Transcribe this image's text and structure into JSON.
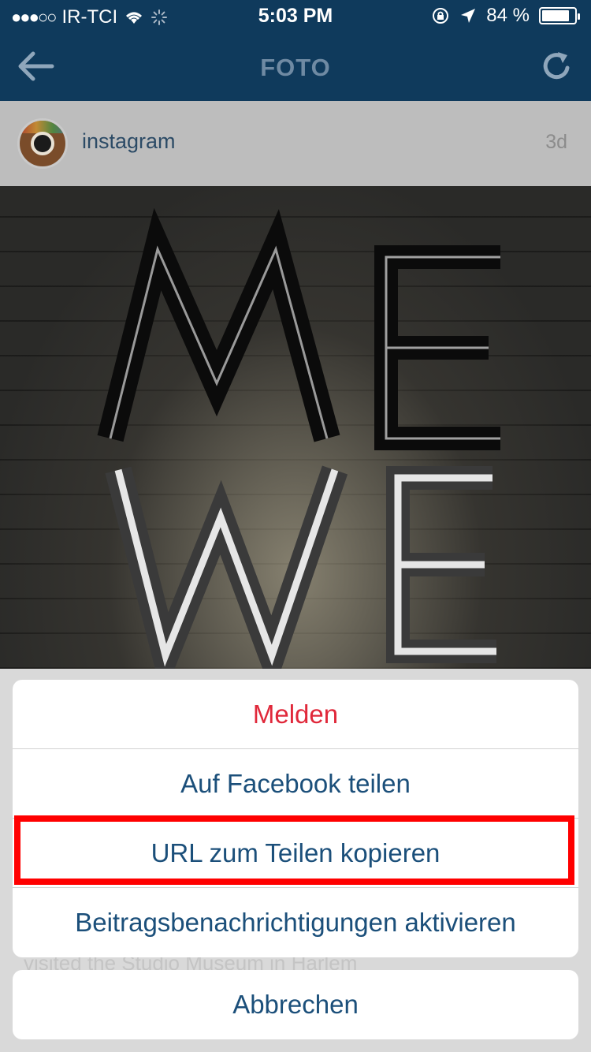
{
  "status_bar": {
    "carrier": "IR-TCI",
    "time": "5:03 PM",
    "battery_percent": "84 %",
    "battery_level": 0.84
  },
  "nav": {
    "title": "FOTO",
    "back_icon": "arrow-left-icon",
    "refresh_icon": "refresh-icon"
  },
  "post": {
    "username": "instagram",
    "time_ago": "3d",
    "caption_partial": "visited the Studio Museum in Harlem"
  },
  "action_sheet": {
    "items": [
      {
        "label": "Melden",
        "style": "destructive"
      },
      {
        "label": "Auf Facebook teilen",
        "style": "default"
      },
      {
        "label": "URL zum Teilen kopieren",
        "style": "default",
        "highlighted": true
      },
      {
        "label": "Beitragsbenachrichtigungen aktivieren",
        "style": "default"
      }
    ],
    "cancel_label": "Abbrechen"
  },
  "colors": {
    "nav_bg": "#0f3a5c",
    "action_text": "#1b4f7a",
    "destructive": "#e0283a",
    "highlight_border": "#ff0000"
  }
}
